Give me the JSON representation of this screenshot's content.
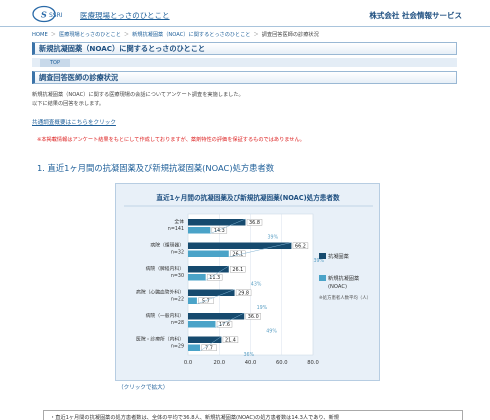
{
  "header": {
    "logo_text": "SSRI",
    "site_title": "医療現場とっさのひとこと",
    "company": "株式会社 社会情報サービス"
  },
  "breadcrumb": [
    "HOME",
    "医療現場とっさのひとこと",
    "新規抗凝固薬（NOAC）に関するとっさのひとこと",
    "調査回答医師の診療状況"
  ],
  "page_title": "新規抗凝固薬（NOAC）に関するとっさのひとこと",
  "top_tab": "TOP",
  "section_title": "調査回答医師の診療状況",
  "intro": [
    "新規抗凝固薬（NOAC）に関する医療現場の会話についてアンケート調査を実施しました。",
    "以下に結果の回答を示します。"
  ],
  "link_summary": "共通調査概要はこちらをクリック",
  "notice": "※本掲載情報はアンケート結果をもとにして作成しておりますが、薬剤特性の評価を保証するものではありません。",
  "question_title": "1. 直近1ヶ月間の抗凝固薬及び新規抗凝固薬(NOAC)処方患者数",
  "enlarge_link": "（クリックで拡大）",
  "bottom_note": "・直近1ヶ月間の抗凝固薬の処方患者数は、全体の平均で36.8人、新規抗凝固薬(NOAC)の処方患者数は14.3人であり、新規",
  "colors": {
    "dark": "#164a6e",
    "light": "#4aa3c8",
    "pct": "#5a9fc4"
  },
  "chart_data": {
    "type": "bar",
    "title": "直近1ヶ月間の抗凝固薬及び新規抗凝固薬(NOAC)処方患者数",
    "orientation": "horizontal",
    "categories": [
      {
        "name": "全体",
        "n": "n=141"
      },
      {
        "name": "病院（循環器）",
        "n": "n=32"
      },
      {
        "name": "病院（脾経内科）",
        "n": "n=30"
      },
      {
        "name": "病院（心臓血管外科）",
        "n": "n=22"
      },
      {
        "name": "病院（一般内科）",
        "n": "n=28"
      },
      {
        "name": "医院・診療所（内科）",
        "n": "n=29"
      }
    ],
    "series": [
      {
        "name": "抗凝固薬",
        "values": [
          36.8,
          66.2,
          26.1,
          29.8,
          36.0,
          21.4
        ]
      },
      {
        "name": "新規抗凝固薬(NOAC)",
        "values": [
          14.3,
          26.1,
          11.3,
          5.7,
          17.6,
          7.7
        ]
      }
    ],
    "percentages": [
      "39%",
      "39%",
      "43%",
      "19%",
      "49%",
      "36%"
    ],
    "xlim": [
      0,
      80
    ],
    "xticks": [
      "0.0",
      "20.0",
      "40.0",
      "60.0",
      "80.0"
    ],
    "legend_note": "※処方患者人数平均（人）",
    "grid": true,
    "legend": "right"
  }
}
